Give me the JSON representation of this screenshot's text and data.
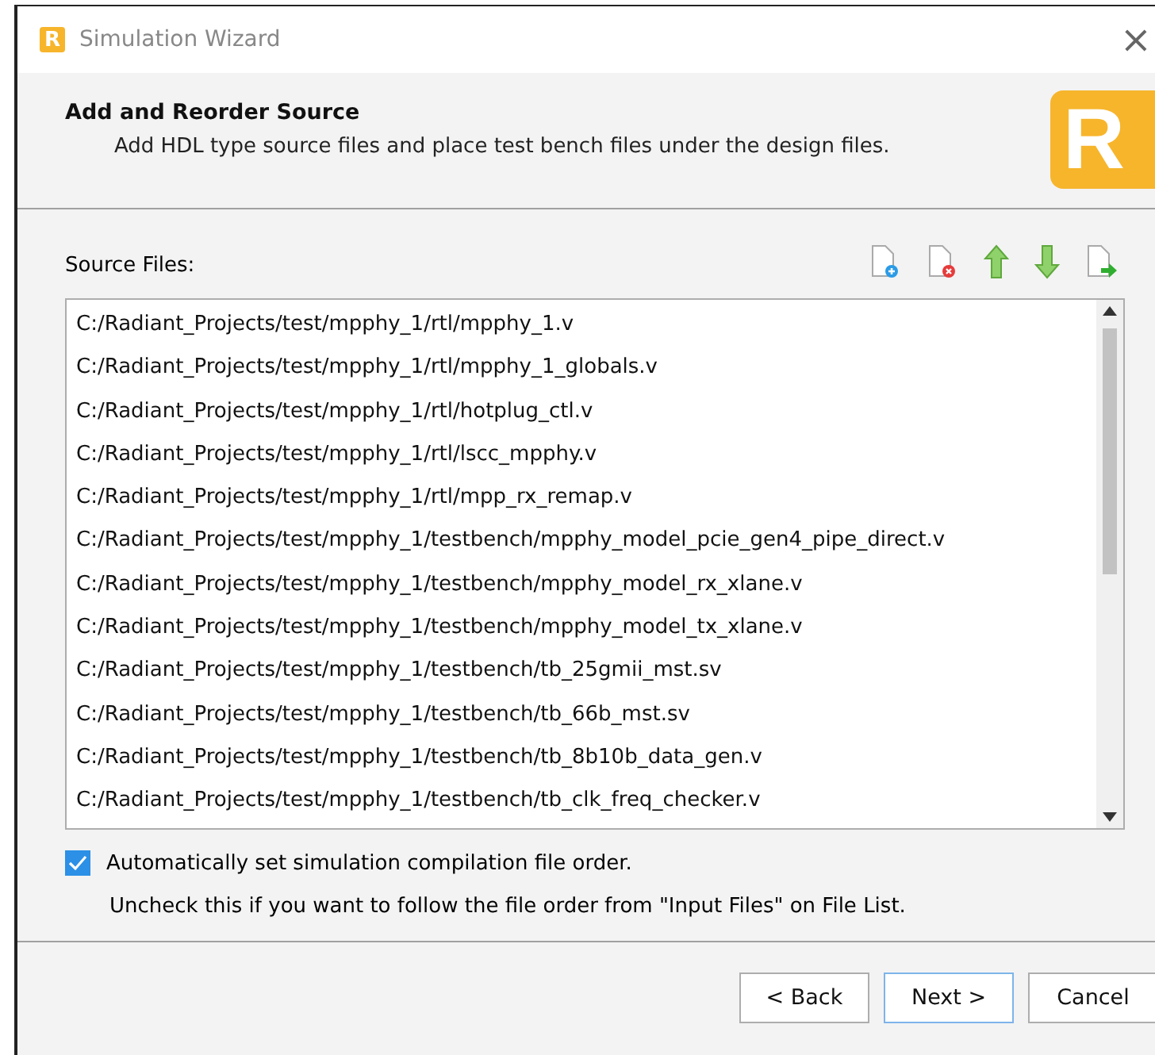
{
  "window": {
    "title": "Simulation Wizard",
    "icon_letter": "R",
    "close": "×"
  },
  "header": {
    "title": "Add and Reorder Source",
    "subtitle": "Add HDL type source files and place test bench files under the design files.",
    "logo_letter": "R"
  },
  "source_files": {
    "label": "Source Files:",
    "files": [
      "C:/Radiant_Projects/test/mpphy_1/rtl/mpphy_1.v",
      "C:/Radiant_Projects/test/mpphy_1/rtl/mpphy_1_globals.v",
      "C:/Radiant_Projects/test/mpphy_1/rtl/hotplug_ctl.v",
      "C:/Radiant_Projects/test/mpphy_1/rtl/lscc_mpphy.v",
      "C:/Radiant_Projects/test/mpphy_1/rtl/mpp_rx_remap.v",
      "C:/Radiant_Projects/test/mpphy_1/testbench/mpphy_model_pcie_gen4_pipe_direct.v",
      "C:/Radiant_Projects/test/mpphy_1/testbench/mpphy_model_rx_xlane.v",
      "C:/Radiant_Projects/test/mpphy_1/testbench/mpphy_model_tx_xlane.v",
      "C:/Radiant_Projects/test/mpphy_1/testbench/tb_25gmii_mst.sv",
      "C:/Radiant_Projects/test/mpphy_1/testbench/tb_66b_mst.sv",
      "C:/Radiant_Projects/test/mpphy_1/testbench/tb_8b10b_data_gen.v",
      "C:/Radiant_Projects/test/mpphy_1/testbench/tb_clk_freq_checker.v"
    ]
  },
  "auto_order": {
    "label": "Automatically set simulation compilation file order.",
    "checked": true,
    "note": "Uncheck this if you want to follow the file order from \"Input Files\" on File List."
  },
  "buttons": [
    {
      "label": "< Back",
      "default": false
    },
    {
      "label": "Next >",
      "default": true
    },
    {
      "label": "Cancel",
      "default": false
    }
  ]
}
